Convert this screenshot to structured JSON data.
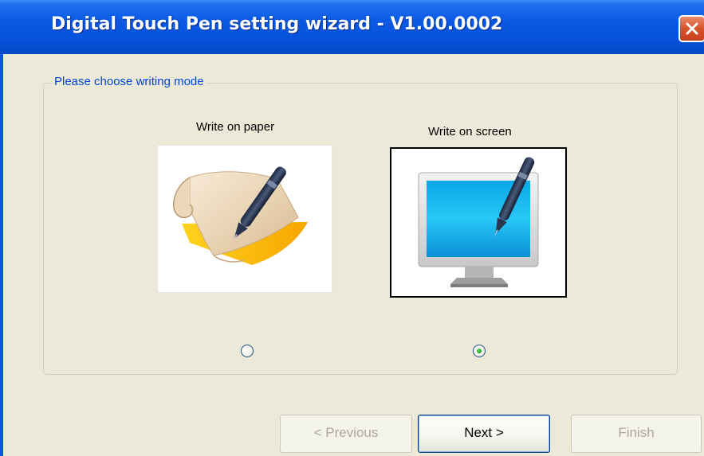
{
  "window": {
    "title": "Digital Touch Pen setting wizard - V1.00.0002",
    "close_icon": "close-icon"
  },
  "group": {
    "legend": "Please choose writing mode"
  },
  "modes": [
    {
      "label": "Write on paper",
      "icon": "paper-pen-icon",
      "selected": false
    },
    {
      "label": "Write on screen",
      "icon": "monitor-pen-icon",
      "selected": true
    }
  ],
  "buttons": {
    "previous": {
      "label": "< Previous",
      "enabled": false
    },
    "next": {
      "label": "Next >",
      "enabled": true
    },
    "finish": {
      "label": "Finish",
      "enabled": false
    }
  },
  "colors": {
    "titlebar": "#0a58e3",
    "legend_text": "#0046d5",
    "dialog_bg": "#ece9d8",
    "close_button": "#d9532c"
  }
}
